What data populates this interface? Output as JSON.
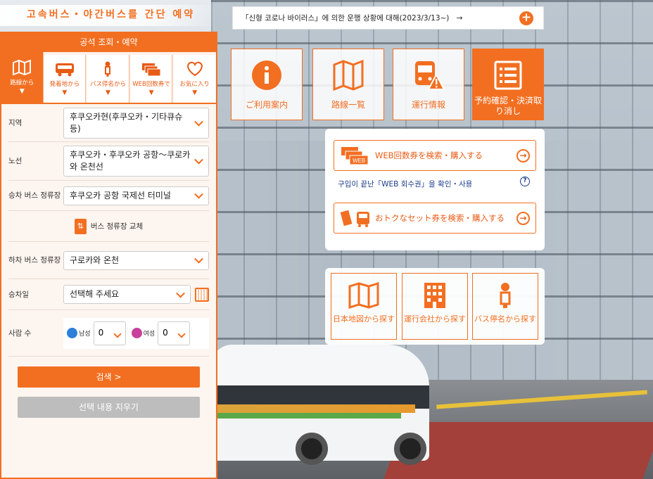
{
  "header": {
    "logo_text": "고속버스・야간버스를 간단 예약",
    "notice_text": "「신형 코로나 바이러스」에 의한 운행 상황에 대해(2023/3/13~)",
    "notice_arrow": "→",
    "plus": "+"
  },
  "panel": {
    "title": "공석 조회・예약",
    "tabs": [
      {
        "label": "路線から",
        "arrow": "▼"
      },
      {
        "label": "発着地から",
        "arrow": "▼"
      },
      {
        "label": "バス停名から",
        "arrow": "▼"
      },
      {
        "label": "WEB回数券で",
        "arrow": "▼"
      },
      {
        "label": "お気に入り",
        "arrow": "▼"
      }
    ],
    "fields": {
      "region_label": "지역",
      "region_value": "후쿠오카현(후쿠오카・기타큐슈 등)",
      "route_label": "노선",
      "route_value": "후쿠오카・후쿠오카 공항～쿠로카와 온천선",
      "board_label": "승차 버스 정류장",
      "board_value": "후쿠오카 공항 국제선 터미널",
      "swap_label": "버스 정류장 교체",
      "alight_label": "하차 버스 정류장",
      "alight_value": "구로카와 온천",
      "date_label": "승차일",
      "date_value": "선택해 주세요",
      "people_label": "사람 수",
      "male_label": "남성",
      "male_value": "0",
      "female_label": "여성",
      "female_value": "0"
    },
    "search_button": "검색 >",
    "clear_button": "선택 내용 지우기"
  },
  "tiles": [
    {
      "label": "ご利用案内"
    },
    {
      "label": "路線一覧"
    },
    {
      "label": "運行情報"
    },
    {
      "label": "予約確認・決済取り消し"
    }
  ],
  "web": {
    "search_coupon": "WEB回数券を検索・購入する",
    "coupon_note": "구입이 끝난「WEB 회수권」을 확인・사용",
    "set_ticket": "おトクなセット券を検索・購入する",
    "go": "→",
    "help": "?"
  },
  "search_tiles": [
    {
      "label": "日本地図から探す"
    },
    {
      "label": "運行会社から探す"
    },
    {
      "label": "バス停名から探す"
    }
  ],
  "colors": {
    "accent": "#f26f21",
    "link": "#1a3c8a"
  }
}
